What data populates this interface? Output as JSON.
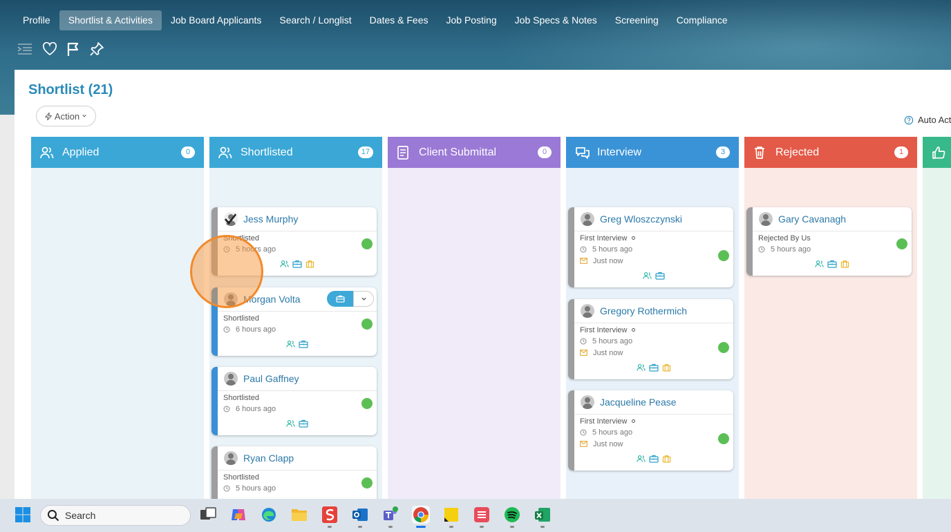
{
  "nav": {
    "tabs": [
      "Profile",
      "Shortlist & Activities",
      "Job Board Applicants",
      "Search / Longlist",
      "Dates & Fees",
      "Job Posting",
      "Job Specs & Notes",
      "Screening",
      "Compliance"
    ],
    "active_tab": "Shortlist & Activities"
  },
  "toolbar": {
    "icons": [
      "collapse-menu-icon",
      "heart-icon",
      "flag-icon",
      "pin-icon"
    ]
  },
  "page": {
    "title": "Shortlist (21)",
    "action_label": "Action",
    "auto_label": "Auto Act"
  },
  "columns": [
    {
      "title": "Applied",
      "count": "0",
      "color": "#3aa7d6",
      "bg": "#eaf3f8",
      "icon": "user-group-icon",
      "cards": []
    },
    {
      "title": "Shortlisted",
      "count": "17",
      "color": "#3aa7d6",
      "bg": "#eaf3f8",
      "icon": "user-group-icon",
      "cards": [
        {
          "name": "Jess Murphy",
          "status": "Shortlisted",
          "time": "5 hours ago",
          "accent": "gray",
          "icons": [
            "people",
            "briefcase",
            "suitcase"
          ],
          "selected": true
        },
        {
          "name": "Morgan Volta",
          "status": "Shortlisted",
          "time": "6 hours ago",
          "accent": "blue",
          "icons": [
            "people",
            "briefcase"
          ],
          "hover": true
        },
        {
          "name": "Paul Gaffney",
          "status": "Shortlisted",
          "time": "6 hours ago",
          "accent": "blue",
          "icons": [
            "people",
            "briefcase"
          ]
        },
        {
          "name": "Ryan Clapp",
          "status": "Shortlisted",
          "time": "5 hours ago",
          "accent": "gray",
          "icons": [
            "people",
            "briefcase"
          ]
        }
      ]
    },
    {
      "title": "Client Submittal",
      "count": "0",
      "color": "#9b79d6",
      "bg": "#f1ebf9",
      "icon": "document-icon",
      "cards": []
    },
    {
      "title": "Interview",
      "count": "3",
      "color": "#3a93d6",
      "bg": "#e8f1f9",
      "icon": "chat-icon",
      "cards": [
        {
          "name": "Greg Wloszczynski",
          "status": "First Interview",
          "time": "5 hours ago",
          "email": "Just now",
          "accent": "gray",
          "icons": [
            "people",
            "briefcase"
          ]
        },
        {
          "name": "Gregory Rothermich",
          "status": "First Interview",
          "time": "5 hours ago",
          "email": "Just now",
          "accent": "gray",
          "icons": [
            "people",
            "briefcase",
            "suitcase"
          ]
        },
        {
          "name": "Jacqueline Pease",
          "status": "First Interview",
          "time": "5 hours ago",
          "email": "Just now",
          "accent": "gray",
          "icons": [
            "people",
            "briefcase",
            "suitcase"
          ]
        }
      ]
    },
    {
      "title": "Rejected",
      "count": "1",
      "color": "#e35a48",
      "bg": "#fbe9e6",
      "icon": "trash-icon",
      "cards": [
        {
          "name": "Gary Cavanagh",
          "status": "Rejected By Us",
          "time": "5 hours ago",
          "accent": "gray",
          "icons": [
            "people",
            "briefcase",
            "suitcase"
          ]
        }
      ]
    },
    {
      "title": "",
      "count": "",
      "color": "#38b98a",
      "bg": "#e6f4ee",
      "icon": "thumbs-up-icon",
      "cards": []
    }
  ],
  "taskbar": {
    "search_placeholder": "Search",
    "apps": [
      "task-view",
      "copilot",
      "edge",
      "file-explorer",
      "wps-office",
      "outlook",
      "teams",
      "chrome",
      "sticky-notes",
      "app-red",
      "spotify",
      "excel"
    ]
  }
}
